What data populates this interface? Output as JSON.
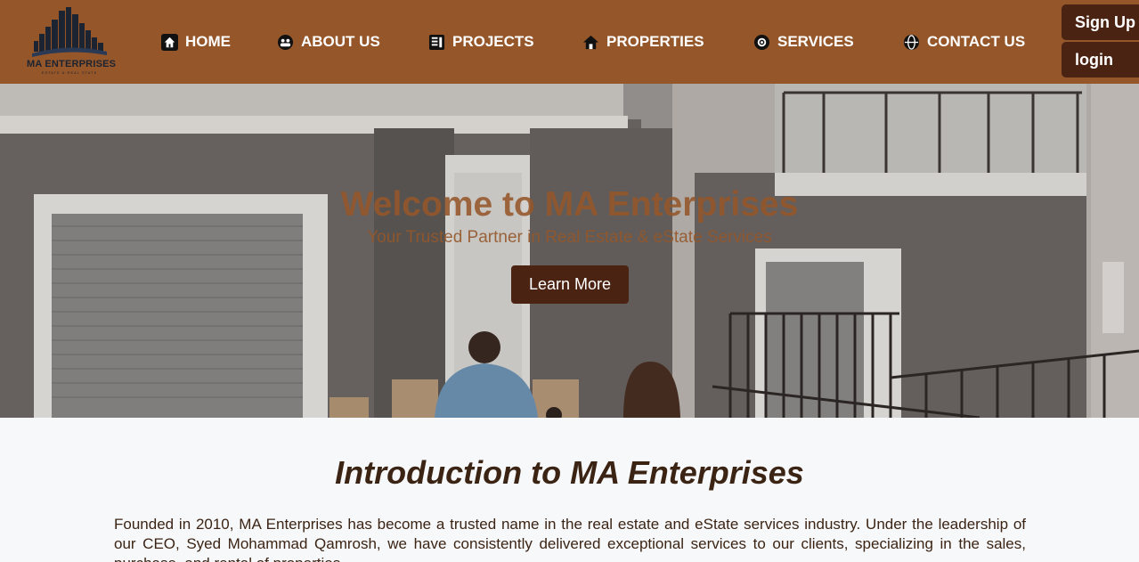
{
  "brand": {
    "name": "MA ENTERPRISES",
    "tagline": "ESTATE & REAL STATE"
  },
  "nav": {
    "items": [
      {
        "label": "HOME",
        "icon": "home-icon"
      },
      {
        "label": "ABOUT US",
        "icon": "people-icon"
      },
      {
        "label": "PROJECTS",
        "icon": "projects-icon"
      },
      {
        "label": "PROPERTIES",
        "icon": "house-icon"
      },
      {
        "label": "SERVICES",
        "icon": "services-icon"
      },
      {
        "label": "CONTACT US",
        "icon": "globe-icon"
      }
    ]
  },
  "auth": {
    "signup_label": "Sign Up",
    "login_label": "login"
  },
  "hero": {
    "title": "Welcome to MA Enterprises",
    "subtitle": "Your Trusted Partner in Real Estate & eState Services",
    "cta_label": "Learn More"
  },
  "intro": {
    "title": "Introduction to MA Enterprises",
    "body": "Founded in 2010, MA Enterprises has become a trusted name in the real estate and eState services industry. Under the leadership of our CEO, Syed Mohammad Qamrosh, we have consistently delivered exceptional services to our clients, specializing in the sales, purchase, and rental of properties."
  },
  "colors": {
    "header_bg": "#95572a",
    "button_bg": "#4b2313",
    "heading_text": "#3b2414"
  }
}
